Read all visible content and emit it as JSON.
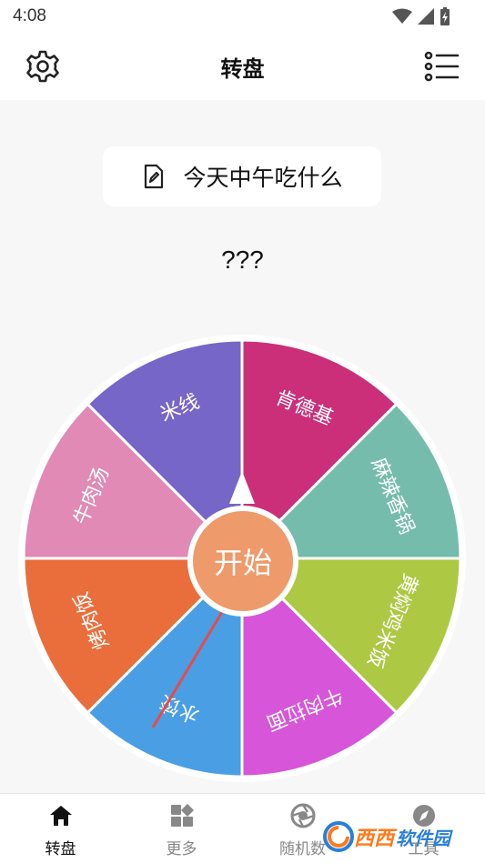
{
  "status_bar": {
    "time": "4:08"
  },
  "header": {
    "title": "转盘"
  },
  "topic": {
    "text": "今天中午吃什么"
  },
  "result": {
    "text": "???"
  },
  "wheel": {
    "start_label": "开始",
    "segments": [
      {
        "label": "肯德基",
        "color": "#cb2f79"
      },
      {
        "label": "麻辣香锅",
        "color": "#75bcad"
      },
      {
        "label": "黄焖鸡米饭",
        "color": "#adc843"
      },
      {
        "label": "牛肉拉面",
        "color": "#d655d8"
      },
      {
        "label": "水饺",
        "color": "#4a9ee4"
      },
      {
        "label": "烤肉饭",
        "color": "#ea6e3c"
      },
      {
        "label": "牛肉汤",
        "color": "#e08ab5"
      },
      {
        "label": "米线",
        "color": "#7566c8"
      }
    ]
  },
  "tabs": [
    {
      "label": "转盘",
      "icon": "home-icon"
    },
    {
      "label": "更多",
      "icon": "grid-icon"
    },
    {
      "label": "随机数",
      "icon": "aperture-icon"
    },
    {
      "label": "工具",
      "icon": "compass-icon"
    }
  ],
  "watermark": {
    "part1": "西西",
    "part2": "软件园"
  },
  "colors": {
    "accent": "#ee9a6a",
    "pointer_arrow": "#e54b4b"
  }
}
